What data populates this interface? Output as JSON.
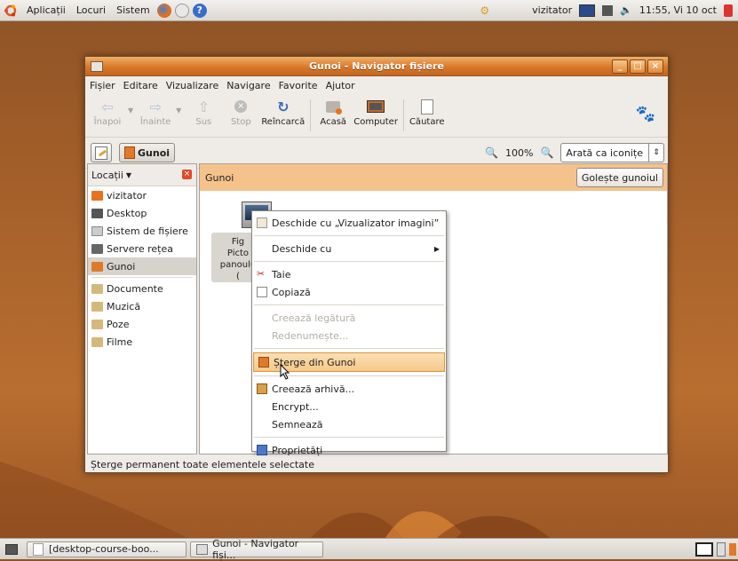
{
  "top_panel": {
    "menus": [
      "Aplicații",
      "Locuri",
      "Sistem"
    ],
    "user": "vizitator",
    "clock": "11:55, Vi 10 oct"
  },
  "window": {
    "title": "Gunoi - Navigator fișiere",
    "menubar": [
      "Fișier",
      "Editare",
      "Vizualizare",
      "Navigare",
      "Favorite",
      "Ajutor"
    ],
    "toolbar": {
      "back": "Înapoi",
      "forward": "Înainte",
      "up": "Sus",
      "stop": "Stop",
      "reload": "Reîncarcă",
      "home": "Acasă",
      "computer": "Computer",
      "search": "Căutare"
    },
    "location": {
      "path_button": "Gunoi",
      "zoom": "100%",
      "view_mode": "Arată ca iconițe"
    },
    "sidebar": {
      "header": "Locații",
      "items": [
        "vizitator",
        "Desktop",
        "Sistem de fișiere",
        "Servere rețea",
        "Gunoi",
        "Documente",
        "Muzică",
        "Poze",
        "Filme"
      ],
      "selected": "Gunoi"
    },
    "main": {
      "trash_label": "Gunoi",
      "empty_button": "Golește gunoiul",
      "file_label_lines": [
        "Fig",
        "Picto",
        "panoulu",
        "("
      ]
    },
    "statusbar": "Șterge permanent toate elementele selectate"
  },
  "context_menu": {
    "items": [
      "Deschide cu „Vizualizator imagini”",
      "Deschide cu",
      "Taie",
      "Copiază",
      "Creează legătură",
      "Redenumește...",
      "Șterge din Gunoi",
      "Creează arhivă...",
      "Encrypt...",
      "Semnează",
      "Proprietăți"
    ]
  },
  "bottom_panel": {
    "tasks": [
      "[desktop-course-boo...",
      "Gunoi - Navigator fiși..."
    ]
  },
  "colors": {
    "title_orange": "#d9782a",
    "highlight": "#f6c98a",
    "trash_bar": "#f5c28b"
  }
}
